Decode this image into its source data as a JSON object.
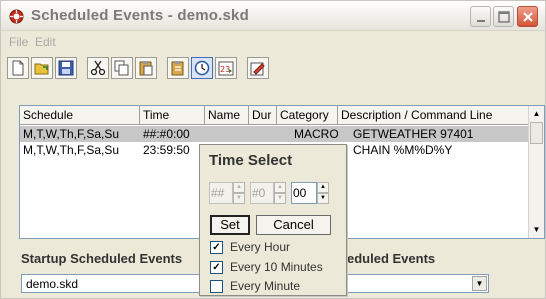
{
  "window": {
    "title": "Scheduled Events - demo.skd"
  },
  "menu": {
    "items": [
      "File",
      "Edit"
    ]
  },
  "toolbar": {
    "buttons": [
      "new-doc-icon",
      "open-folder-icon",
      "save-icon",
      "cut-icon",
      "copy-icon",
      "paste-icon",
      "paste-special-icon",
      "clock-icon",
      "calendar-icon",
      "edit-event-icon"
    ]
  },
  "grid": {
    "columns": [
      "Schedule",
      "Time",
      "Name",
      "Dur",
      "Category",
      "Description / Command Line"
    ],
    "rows": [
      {
        "schedule": "M,T,W,Th,F,Sa,Su",
        "time": "##:#0:00",
        "name": "",
        "dur": "",
        "category": "MACRO",
        "description": "GETWEATHER 97401"
      },
      {
        "schedule": "M,T,W,Th,F,Sa,Su",
        "time": "23:59:50",
        "name": "",
        "dur": "",
        "category": "",
        "description": "CHAIN %M%D%Y"
      }
    ]
  },
  "startup": {
    "label": "Startup Scheduled Events",
    "label2": "eduled Events",
    "file": "demo.skd"
  },
  "time_select": {
    "title": "Time Select",
    "hours": "##",
    "minutes": "#0",
    "seconds": "00",
    "set_label": "Set",
    "cancel_label": "Cancel",
    "options": [
      {
        "label": "Every Hour",
        "checked": true
      },
      {
        "label": "Every 10 Minutes",
        "checked": true
      },
      {
        "label": "Every Minute",
        "checked": false
      }
    ]
  }
}
